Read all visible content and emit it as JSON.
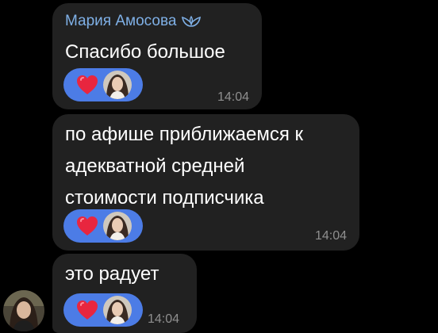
{
  "messages": [
    {
      "sender": "Мария Амосова",
      "badge_icon": "premium-badge-icon",
      "text": "Спасибо большое",
      "reaction": {
        "emoji_icon": "heart-icon",
        "color": "#e8263f"
      },
      "time": "14:04"
    },
    {
      "text": "по афише приближаемся к\nадекватной средней\nстоимости подписчика",
      "reaction": {
        "emoji_icon": "heart-icon",
        "color": "#e8263f"
      },
      "time": "14:04"
    },
    {
      "text": "это радует",
      "reaction": {
        "emoji_icon": "heart-icon",
        "color": "#e8263f"
      },
      "time": "14:04"
    }
  ],
  "colors": {
    "background": "#000000",
    "bubble": "#212121",
    "sender_name": "#7fb0e6",
    "reaction_pill": "#4c7ce6",
    "time": "#8f8f8f"
  }
}
